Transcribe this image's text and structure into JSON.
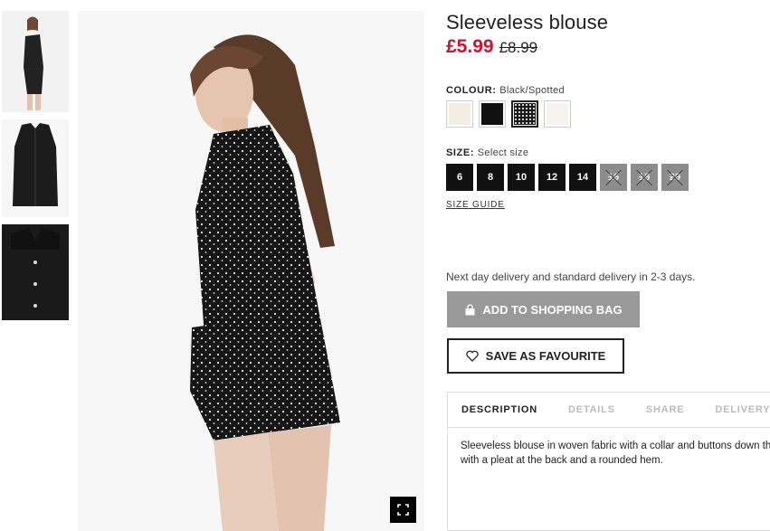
{
  "product": {
    "title": "Sleeveless blouse",
    "price_now": "£5.99",
    "price_old": "£8.99"
  },
  "colour": {
    "label": "COLOUR:",
    "selected": "Black/Spotted",
    "swatches": [
      {
        "name": "Cream",
        "color": "#f4eee2"
      },
      {
        "name": "Black",
        "color": "#111111"
      },
      {
        "name": "Black/Spotted",
        "color": "#1a1a1a"
      },
      {
        "name": "White",
        "color": "#f7f3f1"
      }
    ]
  },
  "size": {
    "label": "SIZE:",
    "prompt": "Select size",
    "options": [
      {
        "label": "6",
        "available": true
      },
      {
        "label": "8",
        "available": true
      },
      {
        "label": "10",
        "available": true
      },
      {
        "label": "12",
        "available": true
      },
      {
        "label": "14",
        "available": true
      },
      {
        "label": "16",
        "available": false
      },
      {
        "label": "18",
        "available": false
      },
      {
        "label": "20",
        "available": false
      }
    ],
    "guide_label": "SIZE GUIDE"
  },
  "delivery_text": "Next day delivery and standard delivery in 2-3 days.",
  "buttons": {
    "add_to_bag": "ADD TO SHOPPING BAG",
    "save_favourite": "SAVE AS FAVOURITE"
  },
  "tabs": {
    "items": [
      "DESCRIPTION",
      "DETAILS",
      "SHARE",
      "DELIVERY"
    ],
    "active": "DESCRIPTION",
    "description_line1": "Sleeveless blouse in woven fabric with a collar and buttons down the front,",
    "description_line2": "with a pleat at the back and a rounded hem."
  },
  "icons": {
    "expand": "expand-icon",
    "bag": "shopping-bag-icon",
    "heart": "heart-icon"
  }
}
